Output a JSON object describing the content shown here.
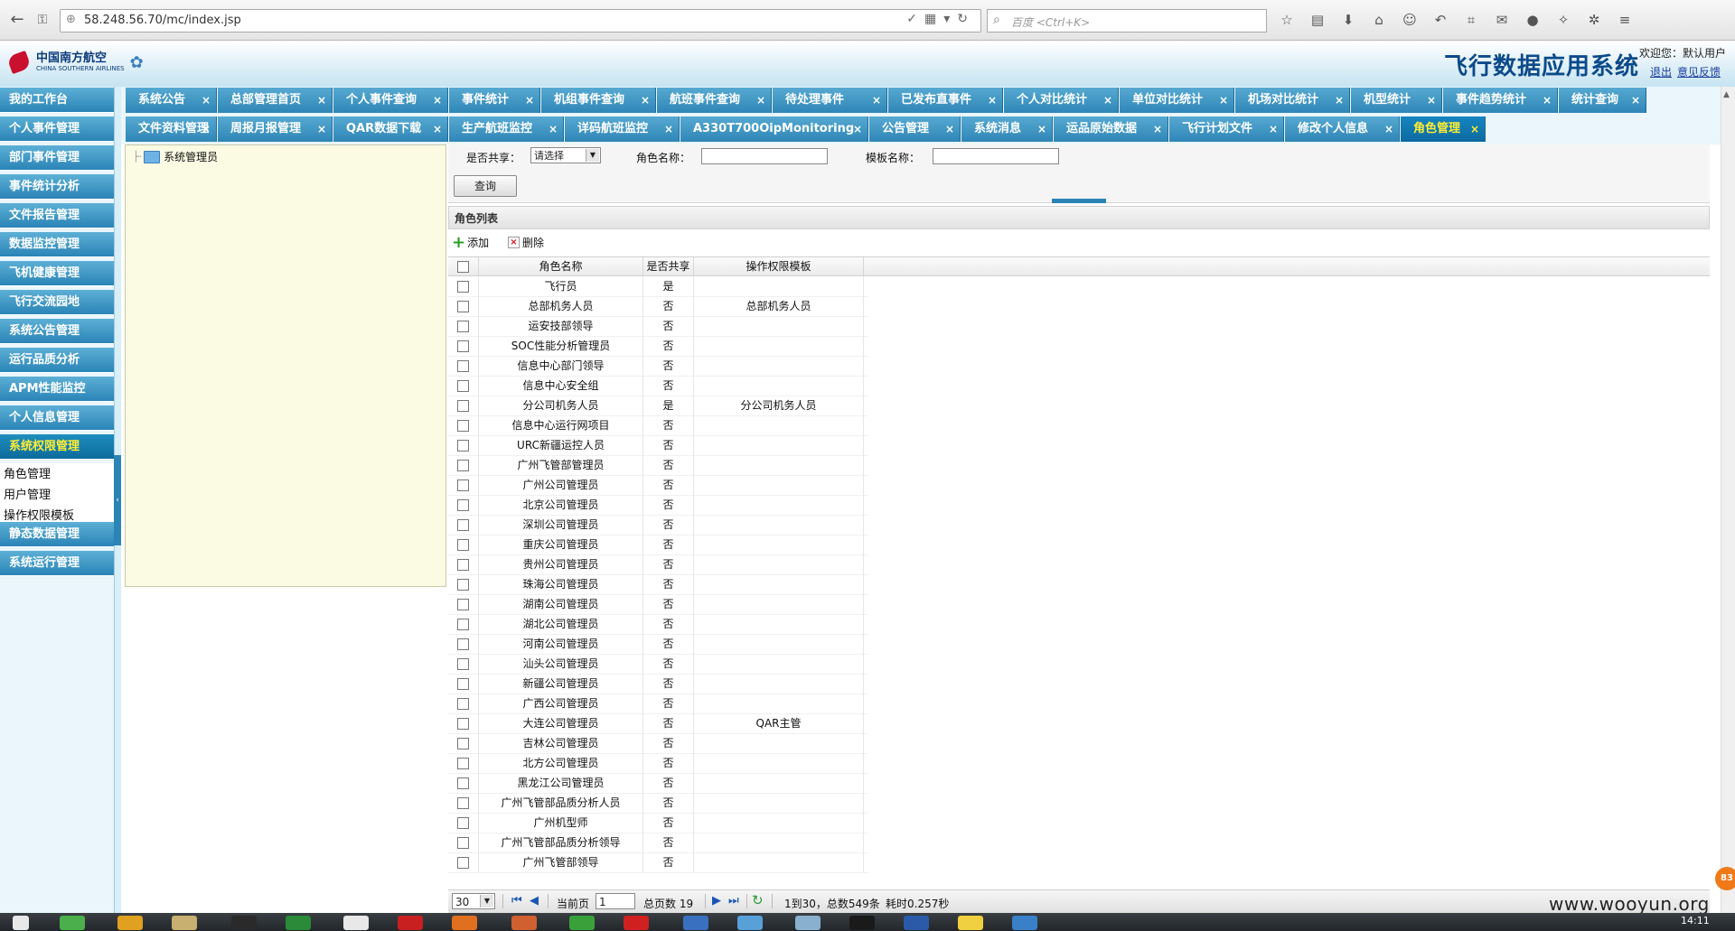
{
  "browser": {
    "url": "58.248.56.70/mc/index.jsp",
    "search_placeholder": "百度 <Ctrl+K>"
  },
  "header": {
    "logo_cn": "中国南方航空",
    "logo_en": "CHINA SOUTHERN AIRLINES",
    "system_title": "飞行数据应用系统",
    "welcome": "欢迎您：默认用户",
    "logout": "退出",
    "feedback": "意见反馈"
  },
  "sidebar": {
    "items": [
      {
        "label": "我的工作台"
      },
      {
        "label": "个人事件管理"
      },
      {
        "label": "部门事件管理"
      },
      {
        "label": "事件统计分析"
      },
      {
        "label": "文件报告管理"
      },
      {
        "label": "数据监控管理"
      },
      {
        "label": "飞机健康管理"
      },
      {
        "label": "飞行交流园地"
      },
      {
        "label": "系统公告管理"
      },
      {
        "label": "运行品质分析"
      },
      {
        "label": "APM性能监控"
      },
      {
        "label": "个人信息管理"
      },
      {
        "label": "系统权限管理"
      },
      {
        "label": "静态数据管理"
      },
      {
        "label": "系统运行管理"
      }
    ],
    "active_item": "系统权限管理",
    "sub_items": [
      "角色管理",
      "用户管理",
      "操作权限模板"
    ]
  },
  "tabs": {
    "row1": [
      "系统公告",
      "总部管理首页",
      "个人事件查询",
      "事件统计",
      "机组事件查询",
      "航班事件查询",
      "待处理事件",
      "已发布直事件",
      "个人对比统计",
      "单位对比统计",
      "机场对比统计",
      "机型统计",
      "事件趋势统计",
      "统计查询"
    ],
    "row2": [
      "文件资料管理",
      "周报月报管理",
      "QAR数据下载",
      "生产航班监控",
      "详码航班监控",
      "A330T700OipMonitoring",
      "公告管理",
      "系统消息",
      "运品原始数据",
      "飞行计划文件",
      "修改个人信息",
      "角色管理"
    ],
    "active": "角色管理",
    "close_glyph": "×"
  },
  "tree": {
    "root": "系统管理员"
  },
  "filter": {
    "share_label": "是否共享：",
    "share_value": "请选择",
    "role_name_label": "角色名称：",
    "template_label": "模板名称：",
    "query_button": "查询"
  },
  "list": {
    "title": "角色列表",
    "add": "添加",
    "delete": "删除",
    "columns": [
      "角色名称",
      "是否共享",
      "操作权限模板"
    ],
    "rows": [
      {
        "name": "飞行员",
        "shared": "是",
        "template": ""
      },
      {
        "name": "总部机务人员",
        "shared": "否",
        "template": "总部机务人员"
      },
      {
        "name": "运安技部领导",
        "shared": "否",
        "template": ""
      },
      {
        "name": "SOC性能分析管理员",
        "shared": "否",
        "template": ""
      },
      {
        "name": "信息中心部门领导",
        "shared": "否",
        "template": ""
      },
      {
        "name": "信息中心安全组",
        "shared": "否",
        "template": ""
      },
      {
        "name": "分公司机务人员",
        "shared": "是",
        "template": "分公司机务人员"
      },
      {
        "name": "信息中心运行网项目",
        "shared": "否",
        "template": ""
      },
      {
        "name": "URC新疆运控人员",
        "shared": "否",
        "template": ""
      },
      {
        "name": "广州飞管部管理员",
        "shared": "否",
        "template": ""
      },
      {
        "name": "广州公司管理员",
        "shared": "否",
        "template": ""
      },
      {
        "name": "北京公司管理员",
        "shared": "否",
        "template": ""
      },
      {
        "name": "深圳公司管理员",
        "shared": "否",
        "template": ""
      },
      {
        "name": "重庆公司管理员",
        "shared": "否",
        "template": ""
      },
      {
        "name": "贵州公司管理员",
        "shared": "否",
        "template": ""
      },
      {
        "name": "珠海公司管理员",
        "shared": "否",
        "template": ""
      },
      {
        "name": "湖南公司管理员",
        "shared": "否",
        "template": ""
      },
      {
        "name": "湖北公司管理员",
        "shared": "否",
        "template": ""
      },
      {
        "name": "河南公司管理员",
        "shared": "否",
        "template": ""
      },
      {
        "name": "汕头公司管理员",
        "shared": "否",
        "template": ""
      },
      {
        "name": "新疆公司管理员",
        "shared": "否",
        "template": ""
      },
      {
        "name": "广西公司管理员",
        "shared": "否",
        "template": ""
      },
      {
        "name": "大连公司管理员",
        "shared": "否",
        "template": "QAR主管"
      },
      {
        "name": "吉林公司管理员",
        "shared": "否",
        "template": ""
      },
      {
        "name": "北方公司管理员",
        "shared": "否",
        "template": ""
      },
      {
        "name": "黑龙江公司管理员",
        "shared": "否",
        "template": ""
      },
      {
        "name": "广州飞管部品质分析人员",
        "shared": "否",
        "template": ""
      },
      {
        "name": "广州机型师",
        "shared": "否",
        "template": ""
      },
      {
        "name": "广州飞管部品质分析领导",
        "shared": "否",
        "template": ""
      },
      {
        "name": "广州飞管部领导",
        "shared": "否",
        "template": ""
      }
    ]
  },
  "pager": {
    "page_size": "30",
    "current_label": "当前页",
    "current_page": "1",
    "total_pages": "总页数 19",
    "summary": "1到30，总数549条",
    "elapsed": "耗时0.257秒"
  },
  "overlay": {
    "watermark": "www.wooyun.org",
    "clock": "14:11",
    "badge": "83"
  },
  "colors": {
    "nav_blue": "#2a84b6",
    "active_text": "#ffee33",
    "tree_bg": "#fbfbe4"
  }
}
